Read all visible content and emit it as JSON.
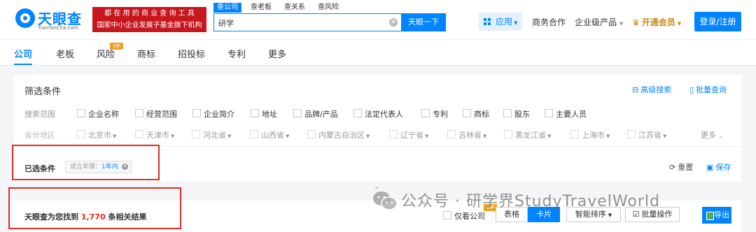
{
  "header": {
    "logo_cn": "天眼查",
    "logo_en": "TianYanCha.com",
    "slogan_line1": "都 在 用 的 商 业 查 询 工 具",
    "slogan_line2": "国家中小企业发展子基金旗下机构",
    "search_tabs": [
      "查公司",
      "查老板",
      "查关系",
      "查风险"
    ],
    "search_value": "研学",
    "search_button": "天眼一下",
    "apps_label": "应用",
    "nav_cooperation": "商务合作",
    "nav_enterprise": "企业级产品",
    "nav_vip": "开通会员",
    "login_button": "登录/注册"
  },
  "tabs": [
    "公司",
    "老板",
    "风险",
    "商标",
    "招投标",
    "专利",
    "更多"
  ],
  "tab_vip_badge": "VIP",
  "filter": {
    "title": "筛选条件",
    "advanced_search": "高级搜索",
    "batch_query": "批量查询",
    "scope_label": "搜索范围",
    "scope_options": [
      "企业名称",
      "经营范围",
      "企业简介",
      "地址",
      "品牌/产品",
      "法定代表人",
      "专利",
      "商标",
      "股东",
      "主要人员"
    ],
    "region_label": "省份地区",
    "provinces": [
      "北京市",
      "天津市",
      "河北省",
      "山西省",
      "内蒙古自治区",
      "辽宁省",
      "吉林省",
      "黑龙江省",
      "上海市",
      "江苏省"
    ],
    "more": "更多"
  },
  "selected": {
    "label": "已选条件",
    "chip_key": "成立年限：",
    "chip_value": "1年内",
    "reset": "重置",
    "save": "保存"
  },
  "result": {
    "prefix": "天眼查为您找到",
    "count": "1,770",
    "suffix": "条相关结果",
    "only_company": "仅看公司",
    "vip_badge": "VIP",
    "view_table": "表格",
    "view_card": "卡片",
    "sort": "智能排序",
    "batch_ops": "批量操作",
    "export": "导出"
  },
  "watermark": "公众号 · 研学界StudyTravelWorld",
  "colors": {
    "brand_blue": "#0084ff",
    "highlight_red": "#e02e24",
    "vip_gold": "#f0a020"
  }
}
